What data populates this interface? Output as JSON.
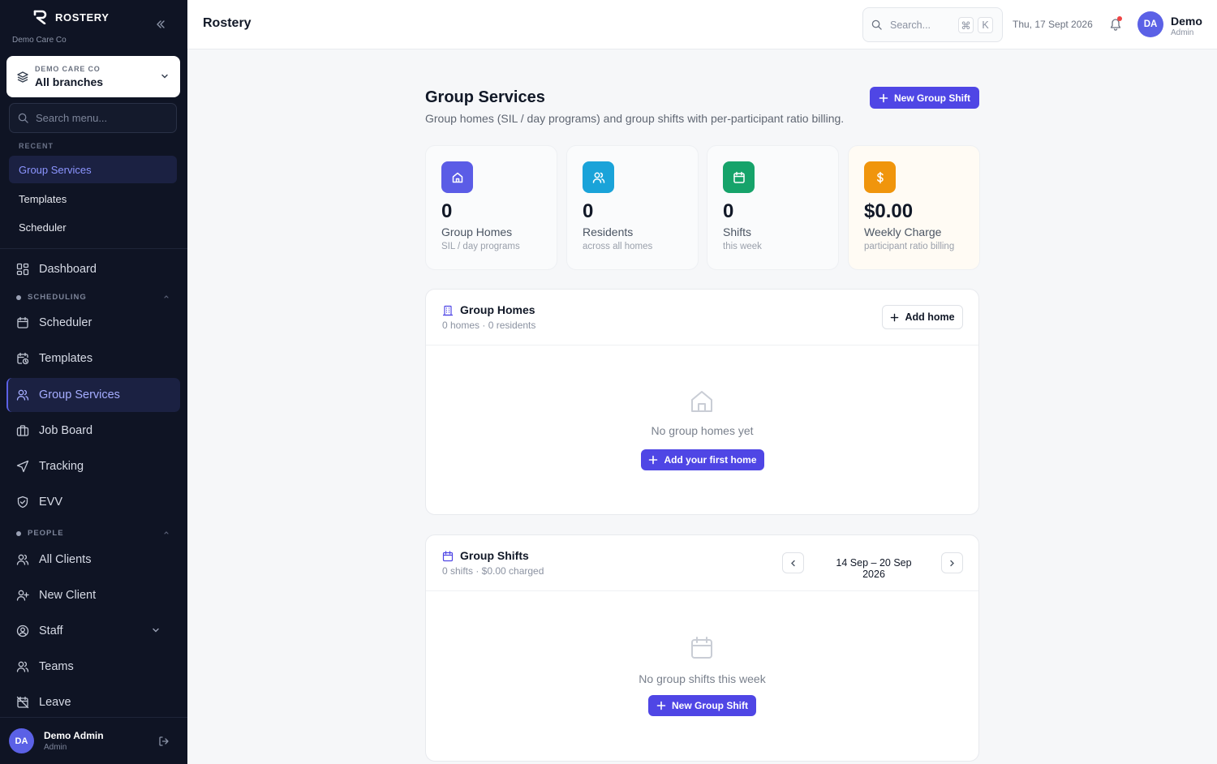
{
  "sidebar": {
    "brand": "ROSTERY",
    "org": "Demo Care Co",
    "branch": {
      "kicker": "DEMO CARE CO",
      "value": "All branches"
    },
    "search_placeholder": "Search menu...",
    "recent_label": "RECENT",
    "recent": [
      "Group Services",
      "Templates",
      "Scheduler"
    ],
    "items": {
      "dashboard": "Dashboard",
      "scheduling": "SCHEDULING",
      "scheduler": "Scheduler",
      "templates": "Templates",
      "group_services": "Group Services",
      "job_board": "Job Board",
      "tracking": "Tracking",
      "evv": "EVV",
      "people": "PEOPLE",
      "all_clients": "All Clients",
      "new_client": "New Client",
      "staff": "Staff",
      "teams": "Teams",
      "leave": "Leave"
    },
    "user": {
      "initials": "DA",
      "name": "Demo Admin",
      "role": "Admin"
    }
  },
  "topbar": {
    "title": "Rostery",
    "search_placeholder": "Search...",
    "kbd": [
      "⌘",
      "K"
    ],
    "date": "Thu, 17 Sept 2026",
    "user": {
      "initials": "DA",
      "name": "Demo",
      "role": "Admin"
    }
  },
  "page": {
    "title": "Group Services",
    "subtitle": "Group homes (SIL / day programs) and group shifts with per-participant ratio billing.",
    "new_shift_label": "New Group Shift"
  },
  "stats": [
    {
      "value": "0",
      "label": "Group Homes",
      "sub": "SIL / day programs",
      "icon": "home-icon",
      "color": "#5b5ce6"
    },
    {
      "value": "0",
      "label": "Residents",
      "sub": "across all homes",
      "icon": "users-icon",
      "color": "#1aa3d9"
    },
    {
      "value": "0",
      "label": "Shifts",
      "sub": "this week",
      "icon": "calendar-icon",
      "color": "#16a36a"
    },
    {
      "value": "$0.00",
      "label": "Weekly Charge",
      "sub": "participant ratio billing",
      "icon": "dollar-icon",
      "color": "#f0950c"
    }
  ],
  "homes_panel": {
    "title": "Group Homes",
    "sub": "0 homes · 0 residents",
    "add_label": "Add home",
    "empty_text": "No group homes yet",
    "empty_cta": "Add your first home"
  },
  "shifts_panel": {
    "title": "Group Shifts",
    "sub": "0 shifts · $0.00 charged",
    "range": "14 Sep – 20 Sep 2026",
    "empty_text": "No group shifts this week",
    "empty_cta": "New Group Shift"
  }
}
